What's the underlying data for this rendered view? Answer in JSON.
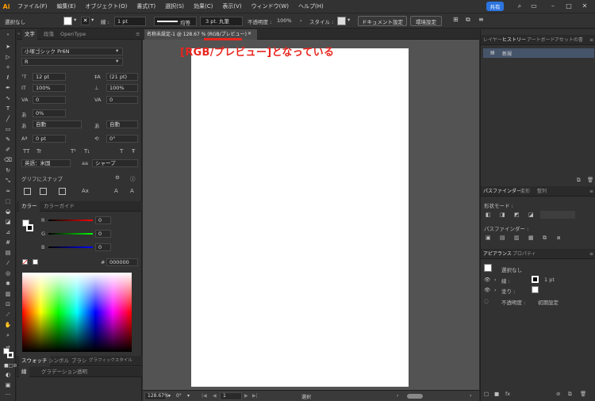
{
  "menubar": {
    "logo": "Ai",
    "items": [
      "ファイル(F)",
      "編集(E)",
      "オブジェクト(O)",
      "書式(T)",
      "選択(S)",
      "効果(C)",
      "表示(V)",
      "ウィンドウ(W)",
      "ヘルプ(H)"
    ],
    "share": "共有"
  },
  "control": {
    "selection": "選択なし",
    "stroke_label": "線 :",
    "stroke_value": "1 pt",
    "profile": "均等",
    "brush": "3 pt. 丸筆",
    "opacity_label": "不透明度 :",
    "opacity_value": "100%",
    "style_label": "スタイル :",
    "doc_settings": "ドキュメント設定",
    "prefs": "環境設定"
  },
  "left": {
    "tabs": [
      "文字",
      "段落",
      "OpenType"
    ],
    "font_family": "小塚ゴシック Pr6N",
    "font_style": "R",
    "size": "12 pt",
    "leading": "(21 pt)",
    "hscale": "100%",
    "vscale": "100%",
    "kerning": "0",
    "tracking": "0",
    "tsume": "0%",
    "aki1": "自動",
    "aki2": "自動",
    "baseline": "0 pt",
    "rotation": "0°",
    "language": "英語：米国",
    "aa": "シャープ",
    "snap": "グリフにスナップ",
    "color_tabs": [
      "カラー",
      "カラーガイド"
    ],
    "r_label": "R",
    "r_val": "0",
    "g_label": "G",
    "g_val": "0",
    "b_label": "B",
    "b_val": "0",
    "hex": "000000",
    "swatch_tabs": [
      "スウォッチ",
      "シンボル",
      "ブラシ",
      "グラフィックスタイル"
    ],
    "bottom_tabs": [
      "線",
      "グラデーション",
      "透明"
    ]
  },
  "doc": {
    "tab_title": "名称未設定-1 @ 128.67 % (RGB/プレビュー)",
    "annotation": "[RGB/プレビュー]となっている",
    "zoom": "128.67%",
    "rotate": "0°",
    "page": "1",
    "status": "選択"
  },
  "right": {
    "tabs": [
      "レイヤー",
      "ヒストリー",
      "アートボード",
      "アセットの書"
    ],
    "history_item": "新規",
    "pf_tabs": [
      "パスファインダー",
      "変形",
      "整列"
    ],
    "shape_mode": "形状モード :",
    "pathfinder": "パスファインダー :",
    "ap_tabs": [
      "アピアランス",
      "プロパティ"
    ],
    "ap_title": "選択なし",
    "ap_stroke": "線 :",
    "ap_stroke_val": "1 pt",
    "ap_fill": "塗り :",
    "ap_opacity": "不透明度 :",
    "ap_opacity_val": "初期設定"
  },
  "colors": {
    "accent": "#e8261e",
    "share": "#2b74e0"
  }
}
